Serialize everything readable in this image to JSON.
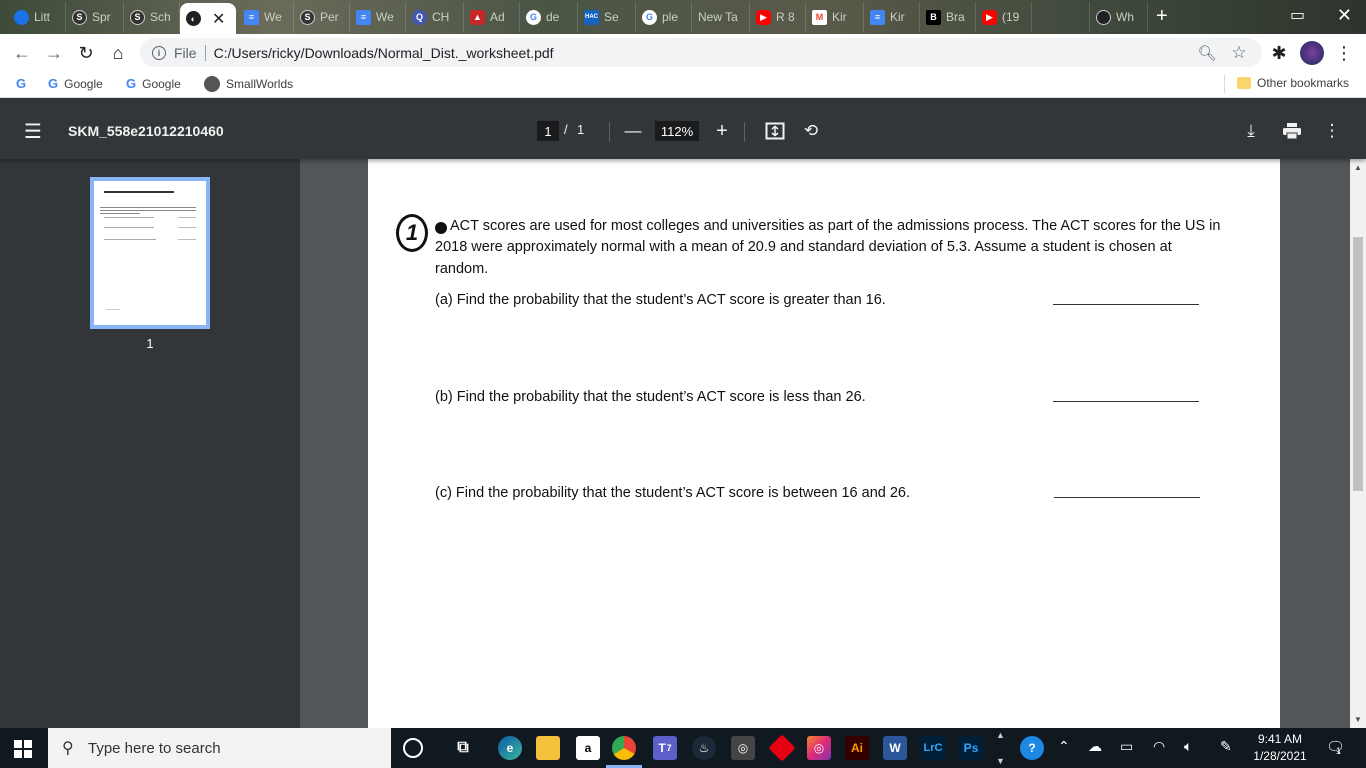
{
  "tabs": [
    {
      "label": "Litt",
      "icon": "globe-icon",
      "color": "#1a73e8"
    },
    {
      "label": "Spr",
      "icon": "schoology-icon",
      "color": "#333333"
    },
    {
      "label": "Sch",
      "icon": "schoology-icon",
      "color": "#333333"
    },
    {
      "label": "",
      "icon": "chrome-pdf-icon",
      "color": "#202124",
      "active": true
    },
    {
      "label": "We",
      "icon": "docs-icon",
      "color": "#4285f4"
    },
    {
      "label": "Per",
      "icon": "schoology-icon",
      "color": "#333333"
    },
    {
      "label": "We",
      "icon": "docs-icon",
      "color": "#4285f4"
    },
    {
      "label": "CH",
      "icon": "quizlet-icon",
      "color": "#4257b2"
    },
    {
      "label": "Ad",
      "icon": "ad-icon",
      "color": "#c62828"
    },
    {
      "label": "de",
      "icon": "google-icon",
      "color": "#ffffff"
    },
    {
      "label": "Se",
      "icon": "hac-icon",
      "color": "#1565c0"
    },
    {
      "label": "ple",
      "icon": "google-icon",
      "color": "#ffffff"
    },
    {
      "label": "New Ta",
      "icon": "",
      "color": ""
    },
    {
      "label": "R 8",
      "icon": "youtube-icon",
      "color": "#ff0000"
    },
    {
      "label": "Kir",
      "icon": "gmail-icon",
      "color": "#ea4335"
    },
    {
      "label": "Kir",
      "icon": "docs-icon",
      "color": "#4285f4"
    },
    {
      "label": "Bra",
      "icon": "brainly-icon",
      "color": "#000000"
    },
    {
      "label": "(19",
      "icon": "youtube-icon",
      "color": "#ff0000"
    },
    {
      "label": "",
      "icon": "",
      "color": ""
    },
    {
      "label": "Wh",
      "icon": "globe-icon",
      "color": "#202124"
    }
  ],
  "address_bar": {
    "scheme": "File",
    "url": "C:/Users/ricky/Downloads/Normal_Dist._worksheet.pdf"
  },
  "bookmarks": {
    "items": [
      {
        "label": "Google"
      },
      {
        "label": "Google"
      },
      {
        "label": "SmallWorlds"
      }
    ],
    "other": "Other bookmarks"
  },
  "pdf": {
    "title": "SKM_558e21012210460",
    "page_current": "1",
    "page_sep": "/",
    "page_total": "1",
    "zoom": "112%",
    "thumbnail_number": "1",
    "question_marker": "1",
    "intro_line1": "ACT scores are used for most colleges and universities as part of the admissions process. The ACT scores for the US in",
    "intro_line2": "2018 were approximately normal with a mean of 20.9 and standard deviation of 5.3. Assume a student is chosen at",
    "intro_line3": "random.",
    "part_a": "(a) Find the probability that the student’s ACT score is greater than 16.",
    "part_b": "(b) Find the probability that the student’s ACT score is less than 26.",
    "part_c": "(c) Find the probability that the student’s ACT score is between 16 and 26."
  },
  "taskbar": {
    "search_placeholder": "Type here to search",
    "time": "9:41 AM",
    "date": "1/28/2021",
    "notification_count": "1",
    "teams_badge": "7"
  },
  "colors": {
    "accent": "#8ab4f8",
    "viewer_bg": "#525659",
    "toolbar_bg": "#323639"
  }
}
